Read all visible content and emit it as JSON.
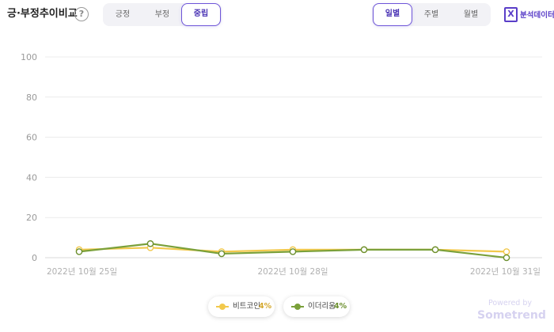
{
  "header": {
    "title": "긍·부정추이비교",
    "help": "?",
    "sentiment_tabs": [
      {
        "label": "긍정",
        "active": false
      },
      {
        "label": "부정",
        "active": false
      },
      {
        "label": "중립",
        "active": true
      }
    ],
    "period_tabs": [
      {
        "label": "일별",
        "active": true
      },
      {
        "label": "주별",
        "active": false
      },
      {
        "label": "월별",
        "active": false
      }
    ],
    "export": {
      "icon": "excel-icon",
      "label": "분석데이터"
    }
  },
  "chart_data": {
    "type": "line",
    "x": [
      "2022-10-25",
      "2022-10-26",
      "2022-10-27",
      "2022-10-28",
      "2022-10-29",
      "2022-10-30",
      "2022-10-31"
    ],
    "x_tick_labels": [
      "2022년 10월 25일",
      "2022년 10월 28일",
      "2022년 10월 31일"
    ],
    "y_ticks": [
      0,
      20,
      40,
      60,
      80,
      100
    ],
    "ylim": [
      0,
      100
    ],
    "grid": true,
    "legend_position": "bottom-center",
    "series": [
      {
        "name": "비트코인",
        "summary": "4%",
        "color": "#f2c94c",
        "values": [
          4,
          5,
          3,
          4,
          4,
          4,
          3
        ]
      },
      {
        "name": "이더리움",
        "summary": "4%",
        "color": "#7aa03a",
        "values": [
          3,
          7,
          2,
          3,
          4,
          4,
          0
        ]
      }
    ]
  },
  "footer": {
    "powered": "Powered by",
    "brand": "Sometrend"
  }
}
